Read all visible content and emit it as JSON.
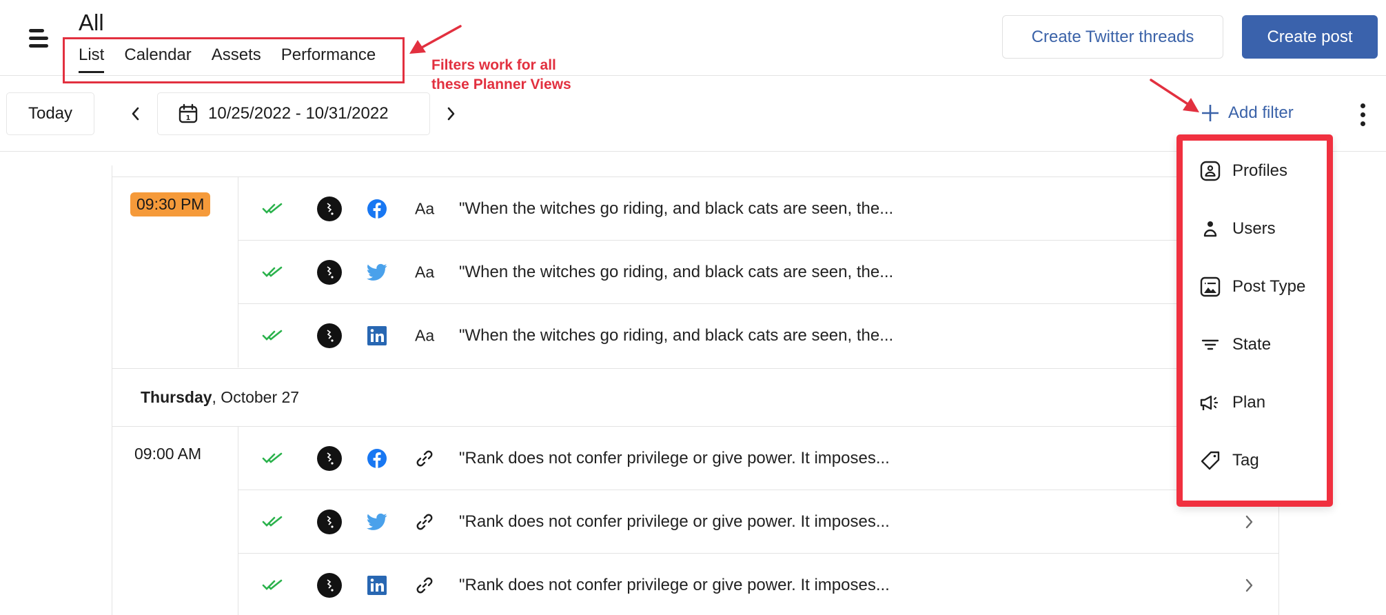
{
  "header": {
    "title": "All",
    "tabs": [
      {
        "label": "List",
        "active": true
      },
      {
        "label": "Calendar",
        "active": false
      },
      {
        "label": "Assets",
        "active": false
      },
      {
        "label": "Performance",
        "active": false
      }
    ],
    "create_threads_label": "Create Twitter threads",
    "create_post_label": "Create post"
  },
  "annotation": {
    "line1": "Filters work for all",
    "line2": "these Planner Views",
    "color": "#e2303f"
  },
  "toolbar": {
    "today_label": "Today",
    "date_range": "10/25/2022 - 10/31/2022",
    "add_filter_label": "Add filter"
  },
  "filter_menu": {
    "items": [
      {
        "label": "Profiles",
        "icon": "profile-card-icon"
      },
      {
        "label": "Users",
        "icon": "user-icon"
      },
      {
        "label": "Post Type",
        "icon": "image-icon"
      },
      {
        "label": "State",
        "icon": "filter-lines-icon"
      },
      {
        "label": "Plan",
        "icon": "megaphone-icon"
      },
      {
        "label": "Tag",
        "icon": "tag-icon"
      }
    ]
  },
  "list": {
    "groups": [
      {
        "time": "09:30 PM",
        "highlighted": true,
        "posts": [
          {
            "status": "published",
            "network": "facebook",
            "type": "text",
            "type_label": "Aa",
            "text": "\"When the witches go riding, and black cats are seen, the..."
          },
          {
            "status": "published",
            "network": "twitter",
            "type": "text",
            "type_label": "Aa",
            "text": "\"When the witches go riding, and black cats are seen, the..."
          },
          {
            "status": "published",
            "network": "linkedin",
            "type": "text",
            "type_label": "Aa",
            "text": "\"When the witches go riding, and black cats are seen, the..."
          }
        ]
      }
    ],
    "day_header": {
      "weekday": "Thursday",
      "date": ", October 27"
    },
    "groups2": [
      {
        "time": "09:00 AM",
        "highlighted": false,
        "posts": [
          {
            "status": "published",
            "network": "facebook",
            "type": "link",
            "text": "\"Rank does not confer privilege or give power. It imposes..."
          },
          {
            "status": "published",
            "network": "twitter",
            "type": "link",
            "text": "\"Rank does not confer privilege or give power. It imposes..."
          },
          {
            "status": "published",
            "network": "linkedin",
            "type": "link",
            "text": "\"Rank does not confer privilege or give power. It imposes..."
          }
        ]
      }
    ]
  },
  "colors": {
    "accent": "#3a62ac",
    "highlight_time": "#f59a3a",
    "annotation_red": "#e2303f",
    "status_green": "#2bb24c",
    "facebook": "#1877f2",
    "twitter": "#4aa1eb",
    "linkedin": "#2867b2"
  }
}
